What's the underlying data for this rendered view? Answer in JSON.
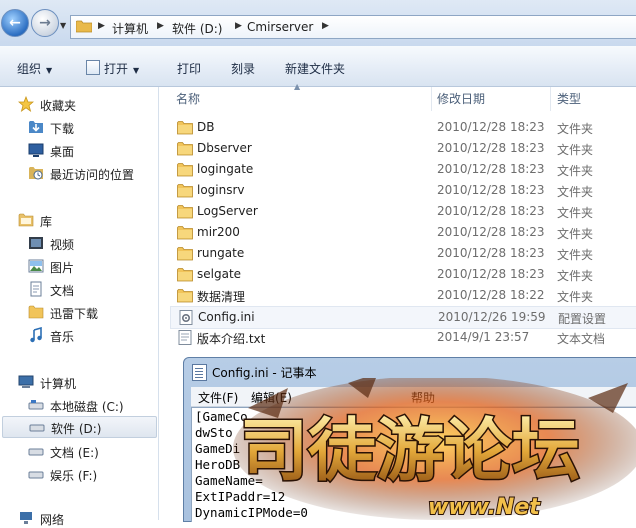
{
  "address_bar": {
    "breadcrumbs": [
      "计算机",
      "软件 (D:)",
      "Cmirserver"
    ]
  },
  "toolbar": {
    "organize": "组织",
    "open": "打开",
    "print": "打印",
    "burn": "刻录",
    "new_folder": "新建文件夹"
  },
  "sidebar": {
    "favorites_header": "收藏夹",
    "favorites": [
      "下载",
      "桌面",
      "最近访问的位置"
    ],
    "libraries_header": "库",
    "libraries": [
      "视频",
      "图片",
      "文档",
      "迅雷下载",
      "音乐"
    ],
    "computer_header": "计算机",
    "drives": [
      "本地磁盘 (C:)",
      "软件 (D:)",
      "文档 (E:)",
      "娱乐 (F:)"
    ],
    "network_header": "网络",
    "selected": "软件 (D:)"
  },
  "columns": {
    "name": "名称",
    "modified": "修改日期",
    "type": "类型"
  },
  "files": [
    {
      "name": "DB",
      "date": "2010/12/28 18:23",
      "type": "文件夹",
      "icon": "folder-icon"
    },
    {
      "name": "Dbserver",
      "date": "2010/12/28 18:23",
      "type": "文件夹",
      "icon": "folder-icon"
    },
    {
      "name": "logingate",
      "date": "2010/12/28 18:23",
      "type": "文件夹",
      "icon": "folder-icon"
    },
    {
      "name": "loginsrv",
      "date": "2010/12/28 18:23",
      "type": "文件夹",
      "icon": "folder-icon"
    },
    {
      "name": "LogServer",
      "date": "2010/12/28 18:23",
      "type": "文件夹",
      "icon": "folder-icon"
    },
    {
      "name": "mir200",
      "date": "2010/12/28 18:23",
      "type": "文件夹",
      "icon": "folder-icon"
    },
    {
      "name": "rungate",
      "date": "2010/12/28 18:23",
      "type": "文件夹",
      "icon": "folder-icon"
    },
    {
      "name": "selgate",
      "date": "2010/12/28 18:23",
      "type": "文件夹",
      "icon": "folder-icon"
    },
    {
      "name": "数据清理",
      "date": "2010/12/28 18:22",
      "type": "文件夹",
      "icon": "folder-icon"
    },
    {
      "name": "Config.ini",
      "date": "2010/12/26 19:59",
      "type": "配置设置",
      "icon": "config-file-icon"
    },
    {
      "name": "版本介绍.txt",
      "date": "2014/9/1 23:57",
      "type": "文本文档",
      "icon": "text-file-icon"
    }
  ],
  "notepad": {
    "title": "Config.ini - 记事本",
    "menus": [
      "文件(F)",
      "编辑(E)",
      "帮助"
    ],
    "lines": [
      "[GameCo",
      "dwSto",
      "GameDi",
      "HeroDB",
      "GameName=",
      "ExtIPaddr=12",
      "DynamicIPMode=0"
    ]
  },
  "watermark": {
    "text": "司徒游论坛",
    "subtext": "www.Net"
  },
  "colors": {
    "folder": "#f1c45a",
    "selection": "#dfe6ef",
    "toolbar": "#e4ecf6",
    "notepad_frame": "#b7cde6"
  }
}
